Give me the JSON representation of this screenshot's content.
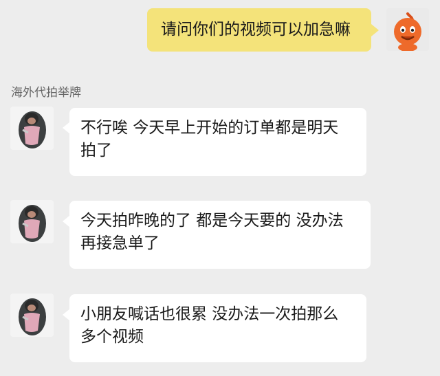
{
  "chat": {
    "outgoing": {
      "text": "请问你们的视频可以加急嘛",
      "avatar_icon": "orange-cartoon-avatar-icon"
    },
    "sender_name": "海外代拍举牌",
    "incoming": [
      {
        "lines": [
          "不行唉 今天早上开始的订单都是明天",
          "拍了"
        ],
        "avatar_icon": "monkey-avatar-icon"
      },
      {
        "lines": [
          "今天拍昨晚的了 都是今天要的 没办法",
          "再接急单了"
        ],
        "avatar_icon": "monkey-avatar-icon"
      },
      {
        "lines": [
          "小朋友喊话也很累 没办法一次拍那么",
          "多个视频"
        ],
        "avatar_icon": "monkey-avatar-icon"
      }
    ]
  },
  "colors": {
    "background": "#ededed",
    "outgoing_bubble": "#f4e37a",
    "incoming_bubble": "#ffffff"
  }
}
